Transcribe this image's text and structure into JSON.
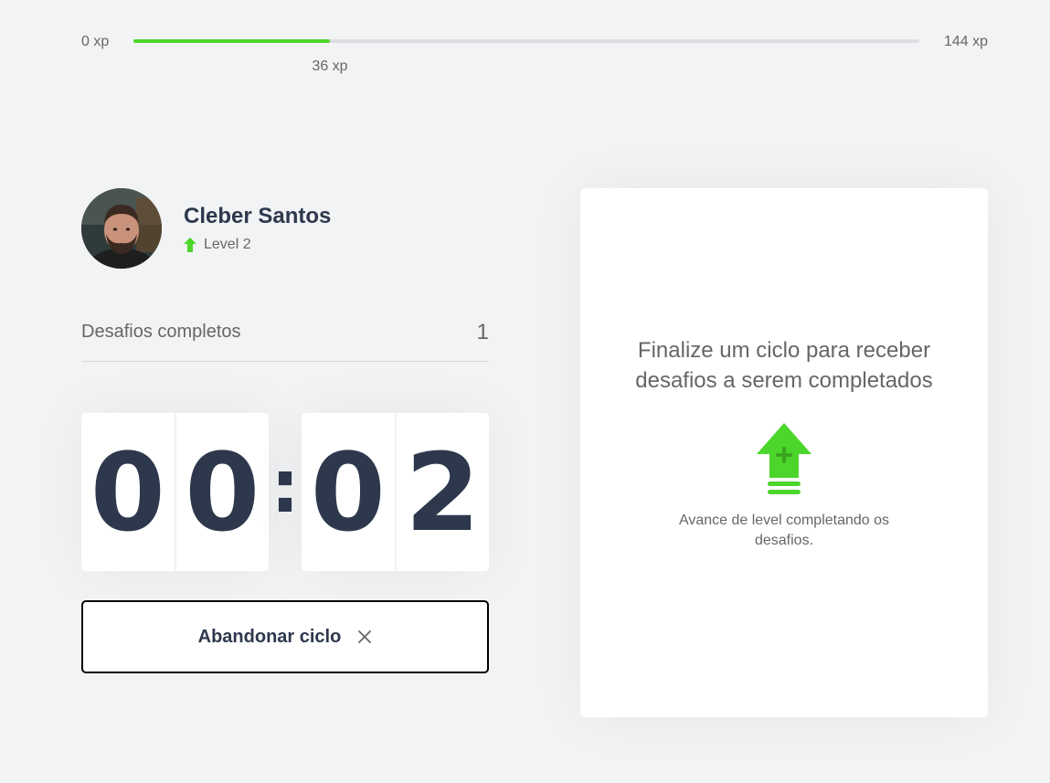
{
  "xp_bar": {
    "min_label": "0 xp",
    "max_label": "144 xp",
    "current_label": "36 xp",
    "progress_fraction": 0.25,
    "fill_color": "#4cd62b"
  },
  "profile": {
    "name": "Cleber Santos",
    "level_label": "Level 2",
    "level_icon": "level-up-arrow-icon"
  },
  "completed_challenges": {
    "label": "Desafios completos",
    "count": "1"
  },
  "countdown": {
    "minute_left": "0",
    "minute_right": "0",
    "separator": ":",
    "second_left": "0",
    "second_right": "2"
  },
  "abandon_button": {
    "label": "Abandonar ciclo",
    "icon": "close-icon"
  },
  "challenge_box": {
    "title": "Finalize um ciclo para receber desafios a serem completados",
    "hint": "Avance de level completando os desafios.",
    "icon": "level-up-icon"
  },
  "colors": {
    "accent_green": "#4cd62b",
    "text_dark": "#2e384d",
    "text_gray": "#666666",
    "background": "#f2f3f5"
  }
}
